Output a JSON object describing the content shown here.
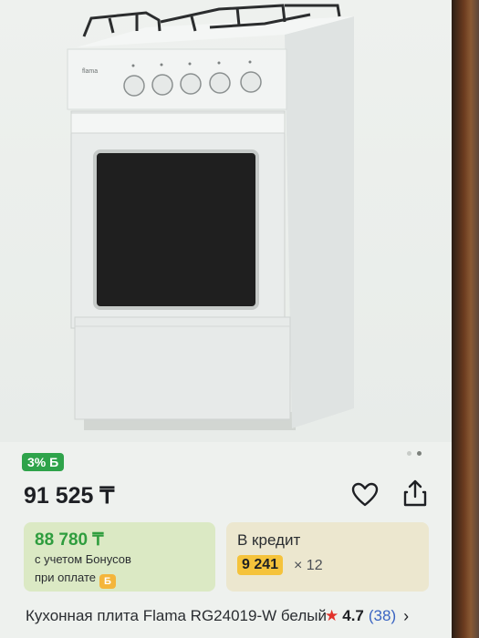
{
  "product": {
    "image_alt": "Кухонная плита",
    "bonus_badge": "3% Б",
    "price": "91 525 ₸",
    "title": "Кухонная плита Flama RG24019-W белый",
    "rating": "4.7",
    "reviews": "(38)"
  },
  "bonus_card": {
    "price": "88 780 ₸",
    "note_line1": "с учетом Бонусов",
    "note_line2": "при оплате",
    "coin_icon": "Б"
  },
  "credit_card": {
    "title": "В кредит",
    "amount": "9 241",
    "term": "× 12"
  },
  "icons": {
    "favorite": "heart-icon",
    "share": "share-icon",
    "more": "chevron-right-icon",
    "rating": "star-icon"
  },
  "colors": {
    "bonus_green": "#2ea34a",
    "credit_yellow": "#f5c33b",
    "star_red": "#e2312a",
    "link_blue": "#3a64c2"
  },
  "carousel": {
    "pages": 2,
    "active_page": 2
  }
}
